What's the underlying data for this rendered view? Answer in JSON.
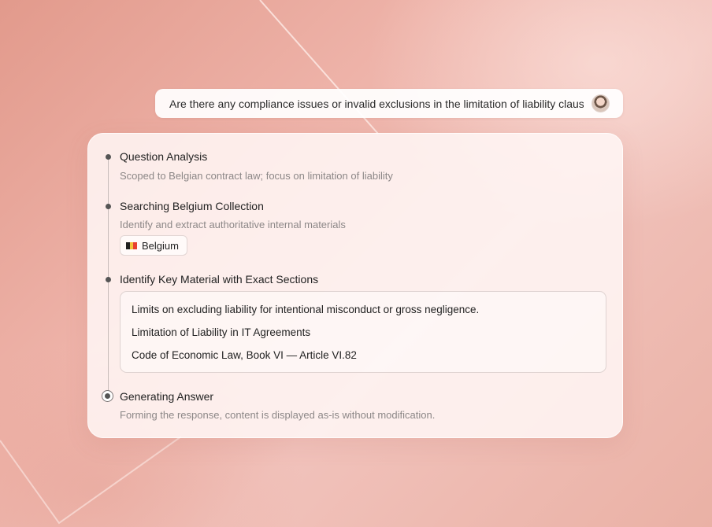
{
  "question": {
    "text": "Are there any compliance issues or invalid exclusions in the limitation of liability clause",
    "avatar_icon": "user-avatar"
  },
  "steps": [
    {
      "title": "Question Analysis",
      "description": "Scoped to Belgian contract law; focus on limitation of liability",
      "status": "done"
    },
    {
      "title": "Searching Belgium Collection",
      "description": "Identify and extract authoritative internal materials",
      "status": "done",
      "tag": {
        "label": "Belgium",
        "icon": "belgium-flag-icon"
      }
    },
    {
      "title": "Identify Key Material with Exact Sections",
      "status": "done",
      "materials": [
        "Limits on excluding liability for intentional misconduct or gross negligence.",
        "Limitation of Liability in IT Agreements",
        "Code of Economic Law, Book VI — Article VI.82"
      ]
    },
    {
      "title": "Generating Answer",
      "description": "Forming the response, content is displayed as-is without modification.",
      "status": "in-progress"
    }
  ],
  "colors": {
    "flag": [
      "#1f1f1f",
      "#f2c23a",
      "#e8402f"
    ],
    "background_accent": "#eeb3a9"
  }
}
